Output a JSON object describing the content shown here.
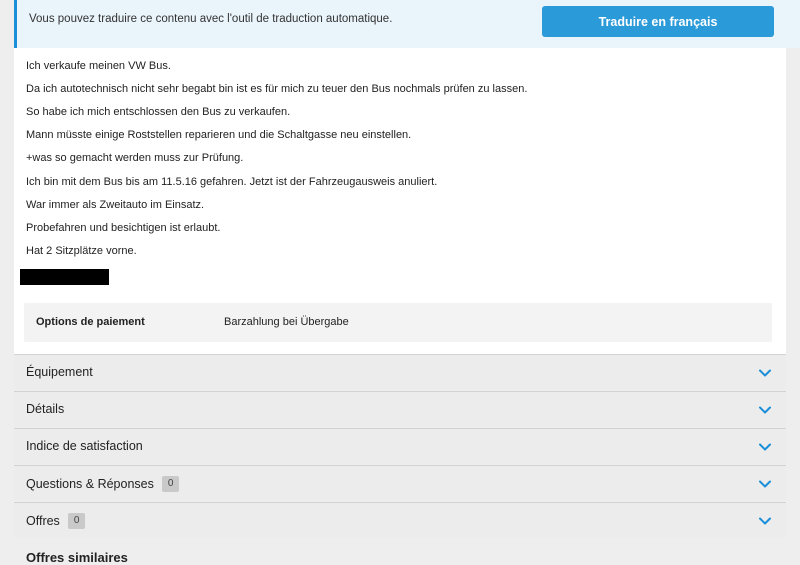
{
  "translate": {
    "message": "Vous pouvez traduire ce contenu avec l'outil de traduction automatique.",
    "button_label": "Traduire en français"
  },
  "description": {
    "lines": [
      "Ich verkaufe meinen VW Bus.",
      "Da ich autotechnisch nicht sehr begabt bin ist es für mich zu teuer den Bus nochmals prüfen zu lassen.",
      "So habe ich mich entschlossen den Bus zu verkaufen.",
      "Mann müsste einige Roststellen reparieren und die Schaltgasse neu einstellen.",
      "+was so gemacht werden muss zur Prüfung.",
      "Ich bin mit dem Bus bis am 11.5.16 gefahren. Jetzt ist der Fahrzeugausweis anuliert.",
      "War immer als Zweitauto im Einsatz.",
      "Probefahren und besichtigen ist erlaubt.",
      "Hat 2 Sitzplätze vorne."
    ]
  },
  "payment": {
    "label": "Options de paiement",
    "value": "Barzahlung bei Übergabe"
  },
  "sections": {
    "equipment": {
      "label": "Équipement"
    },
    "details": {
      "label": "Détails"
    },
    "satisfaction": {
      "label": "Indice de satisfaction"
    },
    "qa": {
      "label": "Questions & Réponses",
      "count": "0"
    },
    "offers": {
      "label": "Offres",
      "count": "0"
    }
  },
  "similar": {
    "title": "Offres similaires"
  },
  "colors": {
    "accent": "#2b9ad9",
    "chevron": "#1a8ed8"
  },
  "icons": {
    "chevron": "chevron-down-icon"
  }
}
